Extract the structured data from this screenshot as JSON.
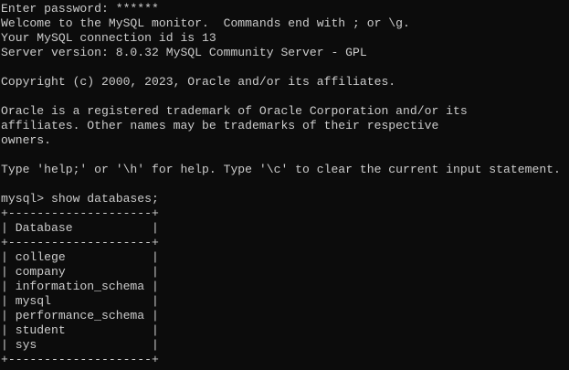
{
  "terminal": {
    "background": "#0c0c0c",
    "foreground": "#cccccc",
    "lines": [
      "Enter password: ******",
      "Welcome to the MySQL monitor.  Commands end with ; or \\g.",
      "Your MySQL connection id is 13",
      "Server version: 8.0.32 MySQL Community Server - GPL",
      "",
      "Copyright (c) 2000, 2023, Oracle and/or its affiliates.",
      "",
      "Oracle is a registered trademark of Oracle Corporation and/or its",
      "affiliates. Other names may be trademarks of their respective",
      "owners.",
      "",
      "Type 'help;' or '\\h' for help. Type '\\c' to clear the current input statement.",
      "",
      "mysql> show databases;",
      "+--------------------+",
      "| Database           |",
      "+--------------------+",
      "| college            |",
      "| company            |",
      "| information_schema |",
      "| mysql              |",
      "| performance_schema |",
      "| student            |",
      "| sys                |",
      "+--------------------+"
    ]
  }
}
